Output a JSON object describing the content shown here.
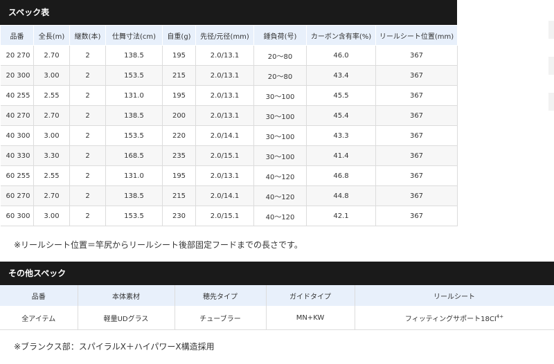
{
  "spec_section": {
    "title": "スペック表",
    "headers": [
      "品番",
      "全長(m)",
      "継数(本)",
      "仕舞寸法(cm)",
      "自重(g)",
      "先径/元径(mm)",
      "錘負荷(号)",
      "カーボン含有率(%)",
      "リールシート位置(mm)"
    ],
    "rows": [
      [
        "20 270",
        "2.70",
        "2",
        "138.5",
        "195",
        "2.0/13.1",
        "20～80",
        "46.0",
        "367"
      ],
      [
        "20 300",
        "3.00",
        "2",
        "153.5",
        "215",
        "2.0/13.1",
        "20～80",
        "43.4",
        "367"
      ],
      [
        "40 255",
        "2.55",
        "2",
        "131.0",
        "195",
        "2.0/13.1",
        "30～100",
        "45.5",
        "367"
      ],
      [
        "40 270",
        "2.70",
        "2",
        "138.5",
        "200",
        "2.0/13.1",
        "30～100",
        "45.4",
        "367"
      ],
      [
        "40 300",
        "3.00",
        "2",
        "153.5",
        "220",
        "2.0/14.1",
        "30～100",
        "43.3",
        "367"
      ],
      [
        "40 330",
        "3.30",
        "2",
        "168.5",
        "235",
        "2.0/15.1",
        "30～100",
        "41.4",
        "367"
      ],
      [
        "60 255",
        "2.55",
        "2",
        "131.0",
        "195",
        "2.0/13.1",
        "40～120",
        "46.8",
        "367"
      ],
      [
        "60 270",
        "2.70",
        "2",
        "138.5",
        "215",
        "2.0/14.1",
        "40～120",
        "44.8",
        "367"
      ],
      [
        "60 300",
        "3.00",
        "2",
        "153.5",
        "230",
        "2.0/15.1",
        "40～120",
        "42.1",
        "367"
      ]
    ],
    "note": "※リールシート位置＝竿尻からリールシート後部固定フードまでの長さです。"
  },
  "other_section": {
    "title": "その他スペック",
    "headers": [
      "品番",
      "本体素材",
      "穂先タイプ",
      "ガイドタイプ",
      "リールシート"
    ],
    "row": {
      "item": "全アイテム",
      "material": "軽量UDグラス",
      "tip": "チューブラー",
      "guide": "MN+KW",
      "reel_seat": "フィッティングサポート18CI",
      "reel_seat_sup": "4+"
    },
    "note": "※ブランクス部：スパイラルX＋ハイパワーX構造採用"
  }
}
